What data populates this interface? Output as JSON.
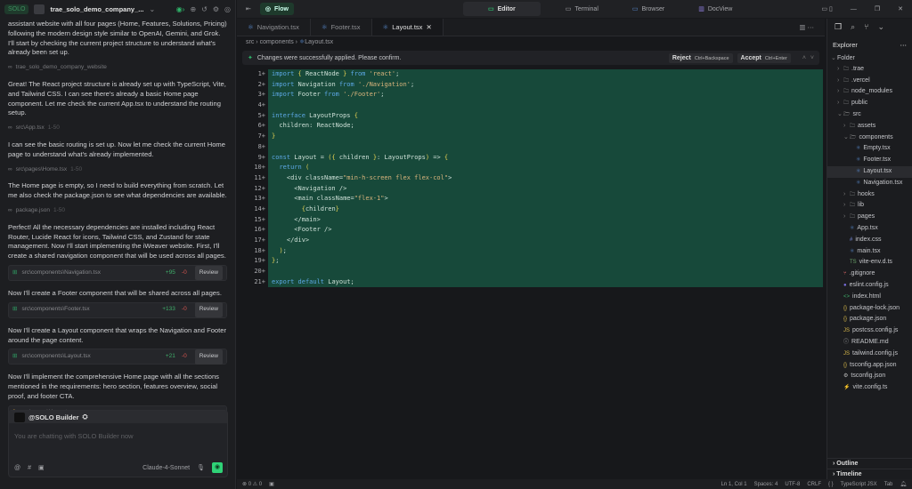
{
  "left": {
    "solo_label": "SOLO",
    "project_title": "trae_solo_demo_company_...",
    "messages": [
      {
        "text": "assistant website with all four pages (Home, Features, Solutions, Pricing) following the modern design style similar to OpenAI, Gemini, and Grok. I'll start by checking the current project structure to understand what's already been set up.",
        "ref": "trae_solo_demo_company_website",
        "range": ""
      },
      {
        "text": "Great! The React project structure is already set up with TypeScript, Vite, and Tailwind CSS. I can see there's already a basic Home page component. Let me check the current App.tsx to understand the routing setup.",
        "ref": "src\\App.tsx",
        "range": "1-50"
      },
      {
        "text": "I can see the basic routing is set up. Now let me check the current Home page to understand what's already implemented.",
        "ref": "src\\pages\\Home.tsx",
        "range": "1-50"
      },
      {
        "text": "The Home page is empty, so I need to build everything from scratch. Let me also check the package.json to see what dependencies are available.",
        "ref": "package.json",
        "range": "1-50"
      }
    ],
    "edits": [
      {
        "text": "Perfect! All the necessary dependencies are installed including React Router, Lucide React for icons, Tailwind CSS, and Zustand for state management. Now I'll start implementing the iWeaver website. First, I'll create a shared navigation component that will be used across all pages.",
        "file": "src\\components\\Navigation.tsx",
        "added": "+95",
        "removed": "-0",
        "review": "Review"
      },
      {
        "text": "Now I'll create a Footer component that will be shared across all pages.",
        "file": "src\\components\\Footer.tsx",
        "added": "+133",
        "removed": "-0",
        "review": "Review"
      },
      {
        "text": "Now I'll create a Layout component that wraps the Navigation and Footer around the page content.",
        "file": "src\\components\\Layout.tsx",
        "added": "+21",
        "removed": "-0",
        "review": "Review"
      }
    ],
    "last_message": "Now I'll implement the comprehensive Home page with all the sections mentioned in the requirements: hero section, features overview, social proof, and footer CTA.",
    "pending_file": "src\\pages\\Home.tsx",
    "status": "Just a moment",
    "input": {
      "agent": "@SOLO Builder",
      "placeholder": "You are chatting with SOLO Builder now",
      "model": "Claude-4-Sonnet"
    }
  },
  "top": {
    "flow": "Flow",
    "views": [
      "Editor",
      "Terminal",
      "Browser",
      "DocView"
    ],
    "active_view": "Editor"
  },
  "tabs": [
    {
      "label": "Navigation.tsx"
    },
    {
      "label": "Footer.tsx"
    },
    {
      "label": "Layout.tsx",
      "active": true
    }
  ],
  "breadcrumb": [
    "src",
    "components",
    "Layout.tsx"
  ],
  "banner": {
    "message": "Changes were successfully applied. Please confirm.",
    "reject": "Reject",
    "reject_key": "Ctrl+Backspace",
    "accept": "Accept",
    "accept_key": "Ctrl+Enter"
  },
  "code": [
    "import { ReactNode } from 'react';",
    "import Navigation from './Navigation';",
    "import Footer from './Footer';",
    "",
    "interface LayoutProps {",
    "  children: ReactNode;",
    "}",
    "",
    "const Layout = ({ children }: LayoutProps) => {",
    "  return (",
    "    <div className=\"min-h-screen flex flex-col\">",
    "      <Navigation />",
    "      <main className=\"flex-1\">",
    "        {children}",
    "      </main>",
    "      <Footer />",
    "    </div>",
    "  );",
    "};",
    "",
    "export default Layout;"
  ],
  "explorer": {
    "title": "Explorer",
    "root": "Folder",
    "items": [
      {
        "name": ".trae",
        "depth": 1,
        "type": "folder"
      },
      {
        "name": ".vercel",
        "depth": 1,
        "type": "folder"
      },
      {
        "name": "node_modules",
        "depth": 1,
        "type": "folder"
      },
      {
        "name": "public",
        "depth": 1,
        "type": "folder"
      },
      {
        "name": "src",
        "depth": 1,
        "type": "folder-open"
      },
      {
        "name": "assets",
        "depth": 2,
        "type": "folder"
      },
      {
        "name": "components",
        "depth": 2,
        "type": "folder-open"
      },
      {
        "name": "Empty.tsx",
        "depth": 3,
        "type": "tsx"
      },
      {
        "name": "Footer.tsx",
        "depth": 3,
        "type": "tsx"
      },
      {
        "name": "Layout.tsx",
        "depth": 3,
        "type": "tsx",
        "selected": true
      },
      {
        "name": "Navigation.tsx",
        "depth": 3,
        "type": "tsx"
      },
      {
        "name": "hooks",
        "depth": 2,
        "type": "folder"
      },
      {
        "name": "lib",
        "depth": 2,
        "type": "folder"
      },
      {
        "name": "pages",
        "depth": 2,
        "type": "folder"
      },
      {
        "name": "App.tsx",
        "depth": 2,
        "type": "tsx"
      },
      {
        "name": "index.css",
        "depth": 2,
        "type": "css"
      },
      {
        "name": "main.tsx",
        "depth": 2,
        "type": "tsx"
      },
      {
        "name": "vite-env.d.ts",
        "depth": 2,
        "type": "ts"
      },
      {
        "name": ".gitignore",
        "depth": 1,
        "type": "git"
      },
      {
        "name": "eslint.config.js",
        "depth": 1,
        "type": "eslint"
      },
      {
        "name": "index.html",
        "depth": 1,
        "type": "html"
      },
      {
        "name": "package-lock.json",
        "depth": 1,
        "type": "json"
      },
      {
        "name": "package.json",
        "depth": 1,
        "type": "json"
      },
      {
        "name": "postcss.config.js",
        "depth": 1,
        "type": "js"
      },
      {
        "name": "README.md",
        "depth": 1,
        "type": "info"
      },
      {
        "name": "tailwind.config.js",
        "depth": 1,
        "type": "js"
      },
      {
        "name": "tsconfig.app.json",
        "depth": 1,
        "type": "json"
      },
      {
        "name": "tsconfig.json",
        "depth": 1,
        "type": "config"
      },
      {
        "name": "vite.config.ts",
        "depth": 1,
        "type": "vite"
      }
    ],
    "outline": "Outline",
    "timeline": "Timeline"
  },
  "status": {
    "errors": "0",
    "warnings": "0",
    "position": "Ln 1, Col 1",
    "spaces": "Spaces: 4",
    "encoding": "UTF-8",
    "eol": "CRLF",
    "language": "TypeScript JSX",
    "tab": "Tab"
  }
}
